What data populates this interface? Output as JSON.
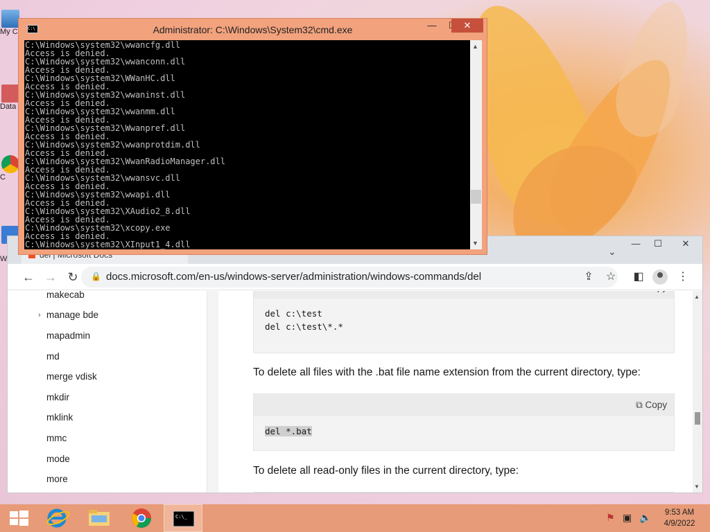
{
  "desktop": {
    "icons": [
      {
        "label": "My C"
      },
      {
        "label": "Data"
      },
      {
        "label": "C"
      },
      {
        "label": "W"
      }
    ]
  },
  "cmd": {
    "title": "Administrator: C:\\Windows\\System32\\cmd.exe",
    "minimize": "—",
    "maximize": "☐",
    "close": "✕",
    "lines": [
      "C:\\Windows\\system32\\wwancfg.dll",
      "Access is denied.",
      "C:\\Windows\\system32\\wwanconn.dll",
      "Access is denied.",
      "C:\\Windows\\system32\\WWanHC.dll",
      "Access is denied.",
      "C:\\Windows\\system32\\wwaninst.dll",
      "Access is denied.",
      "C:\\Windows\\system32\\wwanmm.dll",
      "Access is denied.",
      "C:\\Windows\\system32\\Wwanpref.dll",
      "Access is denied.",
      "C:\\Windows\\system32\\wwanprotdim.dll",
      "Access is denied.",
      "C:\\Windows\\system32\\WwanRadioManager.dll",
      "Access is denied.",
      "C:\\Windows\\system32\\wwansvc.dll",
      "Access is denied.",
      "C:\\Windows\\system32\\wwapi.dll",
      "Access is denied.",
      "C:\\Windows\\system32\\XAudio2_8.dll",
      "Access is denied.",
      "C:\\Windows\\system32\\xcopy.exe",
      "Access is denied.",
      "C:\\Windows\\system32\\XInput1_4.dll"
    ]
  },
  "browser": {
    "tab_partial": "del | Microsoft Docs",
    "minimize": "—",
    "maximize": "☐",
    "close": "✕",
    "url": "docs.microsoft.com/en-us/windows-server/administration/windows-commands/del",
    "nav_items": [
      "makecab",
      "manage bde",
      "mapadmin",
      "md",
      "merge vdisk",
      "mkdir",
      "mklink",
      "mmc",
      "mode",
      "more"
    ],
    "copy_label": "Copy",
    "code1": "del c:\\test\ndel c:\\test\\*.*",
    "para1": "To delete all files with the .bat file name extension from the current directory, type:",
    "code2": "del *.bat",
    "para2": "To delete all read-only files in the current directory, type:"
  },
  "taskbar": {
    "clock_time": "9:53 AM",
    "clock_date": "4/9/2022"
  }
}
